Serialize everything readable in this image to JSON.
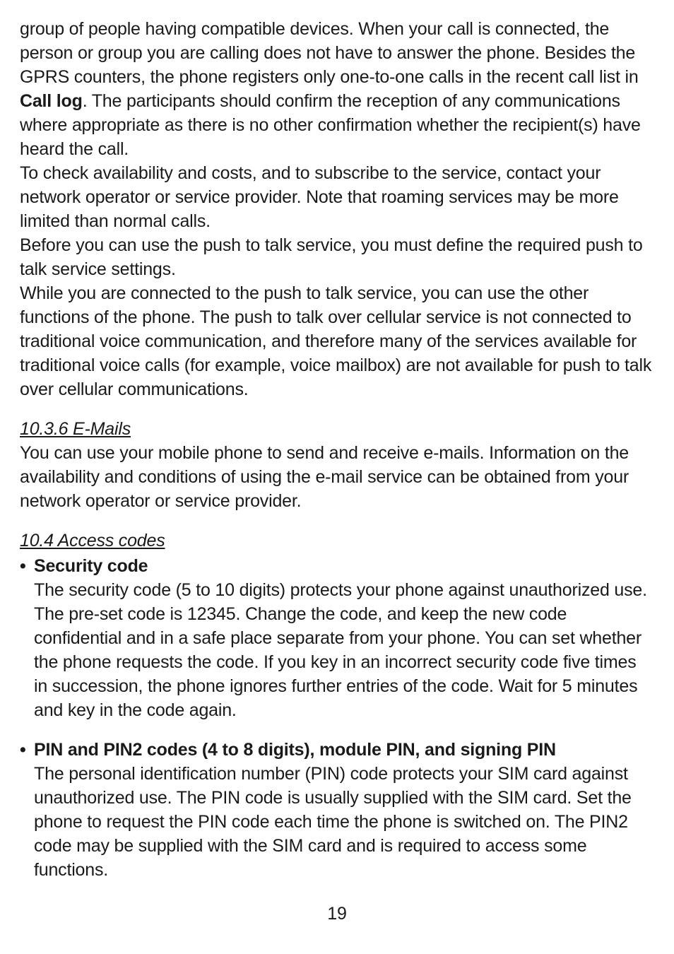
{
  "p1a": "group of people having compatible devices. When your call is connected, the person or group you are calling does not have to answer the phone. Besides the GPRS counters, the phone registers only one-to-one calls in the recent call list in ",
  "p1bold": "Call log",
  "p1b": ". The participants should confirm the reception of any communications where appropriate as there is no other confirmation whether the recipient(s) have heard the call.",
  "p2": "To check availability and costs, and to subscribe to the service, contact your network operator or service provider. Note that roaming services may be more limited than normal calls.",
  "p3": "Before you can use the push to talk service, you must define the required push to talk service settings.",
  "p4": "While you are connected to the push to talk service, you can use the other functions of the phone. The push to talk over cellular service is not connected to traditional voice communication, and therefore many of the services available for traditional voice calls (for example, voice mailbox) are not available for push to talk over cellular communications.",
  "h1": "10.3.6 E-Mails",
  "p5": "You can use your mobile phone to send and receive e-mails. Information on the availability and conditions of using the e-mail service can be obtained from your network operator or service provider.",
  "h2": "10.4  Access codes",
  "b1title": "Security code",
  "b1body": "The security code (5 to 10 digits) protects your phone against unauthorized use. The pre-set code is 12345. Change the code, and keep the new code confidential and in a safe place separate from your phone. You can set whether the phone requests the code. If you key in an incorrect security code five times in succession, the phone ignores further entries of the code. Wait for 5 minutes and key in the code again.",
  "b2title": "PIN and PIN2 codes (4 to 8 digits), module PIN, and signing PIN",
  "b2body": "The personal identification number (PIN) code protects your SIM card against unauthorized use. The PIN code is usually supplied with the SIM card. Set the phone to request the PIN code each time the phone is switched on. The PIN2 code may be supplied with the SIM card and is required to access some functions.",
  "pageNumber": "19",
  "dot": "•"
}
